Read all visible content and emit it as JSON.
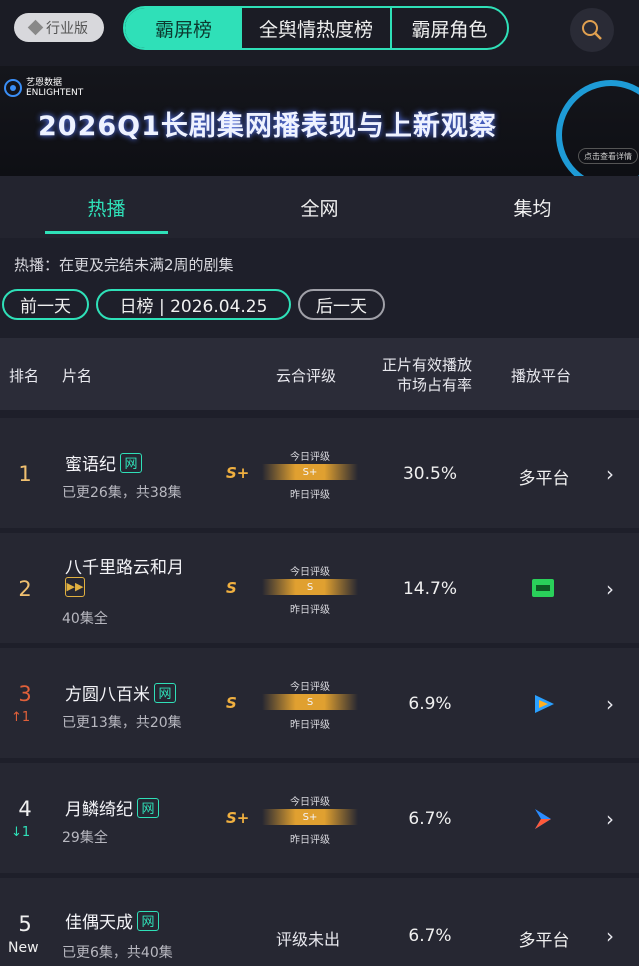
{
  "header": {
    "edition_label": "行业版",
    "segments": [
      "霸屏榜",
      "全舆情热度榜",
      "霸屏角色"
    ],
    "active_segment": "霸屏榜"
  },
  "banner": {
    "logo_cn": "艺恩数据",
    "logo_en": "ENLIGHTENT",
    "title": "2026Q1长剧集网播表现与上新观察",
    "cta": "点击查看详情"
  },
  "tabs": [
    "热播",
    "全网",
    "集均"
  ],
  "active_tab": "热播",
  "note": "热播：在更及完结未满2周的剧集",
  "date_nav": {
    "prev": "前一天",
    "current": "日榜 | 2026.04.25",
    "next": "后一天"
  },
  "columns": {
    "rank": "排名",
    "title": "片名",
    "rating": "云合评级",
    "share_line1": "正片有效播放",
    "share_line2": "市场占有率",
    "platform": "播放平台"
  },
  "gauge_labels": {
    "today": "今日评级",
    "yesterday": "昨日评级"
  },
  "rows": [
    {
      "rank": "1",
      "change": "",
      "title": "蜜语纪",
      "tag": "网",
      "sub": "已更26集，共38集",
      "grade": "S+",
      "gauge_grade": "S+",
      "share": "30.5%",
      "platform": "多平台",
      "platform_icon": ""
    },
    {
      "rank": "2",
      "change": "",
      "title": "八千里路云和月",
      "tag": "",
      "sub": "40集全",
      "grade": "S",
      "gauge_grade": "S",
      "share": "14.7%",
      "platform": "",
      "platform_icon": "iqiyi-icon"
    },
    {
      "rank": "3",
      "change": "↑1",
      "title": "方圆八百米",
      "tag": "网",
      "sub": "已更13集，共20集",
      "grade": "S",
      "gauge_grade": "S",
      "share": "6.9%",
      "platform": "",
      "platform_icon": "tencent-video-icon"
    },
    {
      "rank": "4",
      "change": "↓1",
      "title": "月鳞绮纪",
      "tag": "网",
      "sub": "29集全",
      "grade": "S+",
      "gauge_grade": "S+",
      "share": "6.7%",
      "platform": "",
      "platform_icon": "youku-icon"
    },
    {
      "rank": "5",
      "change": "New",
      "title": "佳偶天成",
      "tag": "网",
      "sub": "已更6集，共40集",
      "grade": "",
      "gauge_grade": "",
      "pending": "评级未出",
      "share": "6.7%",
      "platform": "多平台",
      "platform_icon": ""
    }
  ],
  "colors": {
    "accent": "#2fe0b8",
    "rank_gold": "#f0c070",
    "up": "#e0603a",
    "down": "#2fe0b8",
    "grade": "#f0b040"
  }
}
